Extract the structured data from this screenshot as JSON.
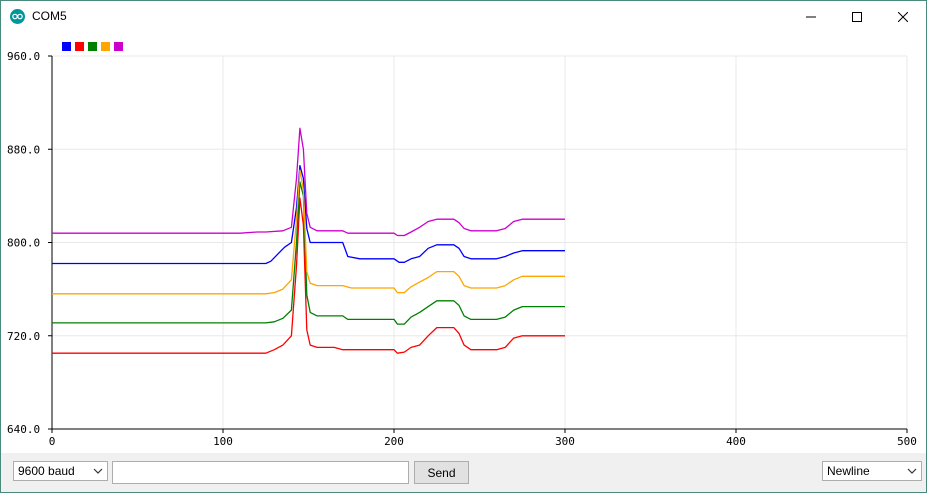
{
  "window": {
    "title": "COM5"
  },
  "controls": {
    "baud_rate": "9600 baud",
    "message_input": "",
    "send_label": "Send",
    "line_ending": "Newline"
  },
  "chart_data": {
    "type": "line",
    "title": "",
    "xlabel": "",
    "ylabel": "",
    "xlim": [
      0,
      500
    ],
    "ylim": [
      640,
      960
    ],
    "x_ticks": [
      0,
      100,
      200,
      300,
      400,
      500
    ],
    "y_ticks": [
      640,
      720,
      800,
      880,
      960
    ],
    "y_tick_labels": [
      "640.0",
      "720.0",
      "800.0",
      "880.0",
      "960.0"
    ],
    "grid": true,
    "legend": "top-left",
    "series": [
      {
        "color": "#0000ff",
        "values": [
          [
            0,
            782
          ],
          [
            125,
            782
          ],
          [
            128,
            784
          ],
          [
            132,
            790
          ],
          [
            136,
            796
          ],
          [
            140,
            800
          ],
          [
            143,
            830
          ],
          [
            145,
            866
          ],
          [
            147,
            855
          ],
          [
            149,
            812
          ],
          [
            151,
            800
          ],
          [
            155,
            800
          ],
          [
            165,
            800
          ],
          [
            170,
            800
          ],
          [
            173,
            788
          ],
          [
            180,
            786
          ],
          [
            200,
            786
          ],
          [
            203,
            783
          ],
          [
            206,
            783
          ],
          [
            210,
            786
          ],
          [
            215,
            788
          ],
          [
            220,
            795
          ],
          [
            225,
            798
          ],
          [
            235,
            798
          ],
          [
            238,
            795
          ],
          [
            241,
            788
          ],
          [
            245,
            786
          ],
          [
            260,
            786
          ],
          [
            265,
            788
          ],
          [
            270,
            791
          ],
          [
            275,
            793
          ],
          [
            300,
            793
          ]
        ]
      },
      {
        "color": "#ff0000",
        "values": [
          [
            0,
            705
          ],
          [
            125,
            705
          ],
          [
            130,
            708
          ],
          [
            135,
            712
          ],
          [
            140,
            720
          ],
          [
            143,
            780
          ],
          [
            145,
            838
          ],
          [
            147,
            815
          ],
          [
            149,
            725
          ],
          [
            151,
            712
          ],
          [
            155,
            710
          ],
          [
            165,
            710
          ],
          [
            170,
            708
          ],
          [
            175,
            708
          ],
          [
            200,
            708
          ],
          [
            202,
            705
          ],
          [
            206,
            706
          ],
          [
            210,
            710
          ],
          [
            215,
            712
          ],
          [
            220,
            720
          ],
          [
            225,
            727
          ],
          [
            235,
            727
          ],
          [
            238,
            722
          ],
          [
            241,
            712
          ],
          [
            245,
            708
          ],
          [
            260,
            708
          ],
          [
            265,
            710
          ],
          [
            270,
            718
          ],
          [
            275,
            720
          ],
          [
            300,
            720
          ]
        ]
      },
      {
        "color": "#008000",
        "values": [
          [
            0,
            731
          ],
          [
            125,
            731
          ],
          [
            130,
            732
          ],
          [
            135,
            735
          ],
          [
            140,
            742
          ],
          [
            143,
            800
          ],
          [
            145,
            852
          ],
          [
            147,
            840
          ],
          [
            149,
            755
          ],
          [
            151,
            740
          ],
          [
            155,
            737
          ],
          [
            170,
            737
          ],
          [
            173,
            734
          ],
          [
            200,
            734
          ],
          [
            202,
            730
          ],
          [
            206,
            730
          ],
          [
            210,
            736
          ],
          [
            215,
            740
          ],
          [
            220,
            745
          ],
          [
            225,
            750
          ],
          [
            235,
            750
          ],
          [
            238,
            746
          ],
          [
            241,
            737
          ],
          [
            245,
            734
          ],
          [
            260,
            734
          ],
          [
            265,
            736
          ],
          [
            270,
            742
          ],
          [
            275,
            745
          ],
          [
            300,
            745
          ]
        ]
      },
      {
        "color": "#ffa500",
        "values": [
          [
            0,
            756
          ],
          [
            125,
            756
          ],
          [
            130,
            757
          ],
          [
            135,
            760
          ],
          [
            140,
            768
          ],
          [
            143,
            820
          ],
          [
            145,
            862
          ],
          [
            147,
            845
          ],
          [
            149,
            775
          ],
          [
            151,
            765
          ],
          [
            155,
            763
          ],
          [
            170,
            763
          ],
          [
            175,
            761
          ],
          [
            200,
            761
          ],
          [
            202,
            757
          ],
          [
            206,
            757
          ],
          [
            210,
            762
          ],
          [
            215,
            766
          ],
          [
            220,
            770
          ],
          [
            225,
            775
          ],
          [
            235,
            775
          ],
          [
            238,
            771
          ],
          [
            241,
            763
          ],
          [
            245,
            761
          ],
          [
            260,
            761
          ],
          [
            265,
            763
          ],
          [
            270,
            768
          ],
          [
            275,
            771
          ],
          [
            300,
            771
          ]
        ]
      },
      {
        "color": "#cc00cc",
        "values": [
          [
            0,
            808
          ],
          [
            110,
            808
          ],
          [
            120,
            809
          ],
          [
            125,
            809
          ],
          [
            135,
            810
          ],
          [
            140,
            813
          ],
          [
            143,
            855
          ],
          [
            145,
            898
          ],
          [
            147,
            880
          ],
          [
            149,
            825
          ],
          [
            151,
            813
          ],
          [
            155,
            810
          ],
          [
            170,
            810
          ],
          [
            173,
            808
          ],
          [
            200,
            808
          ],
          [
            202,
            806
          ],
          [
            206,
            806
          ],
          [
            210,
            809
          ],
          [
            215,
            813
          ],
          [
            220,
            818
          ],
          [
            225,
            820
          ],
          [
            235,
            820
          ],
          [
            238,
            817
          ],
          [
            241,
            812
          ],
          [
            245,
            810
          ],
          [
            260,
            810
          ],
          [
            265,
            812
          ],
          [
            270,
            818
          ],
          [
            275,
            820
          ],
          [
            300,
            820
          ]
        ]
      }
    ]
  }
}
